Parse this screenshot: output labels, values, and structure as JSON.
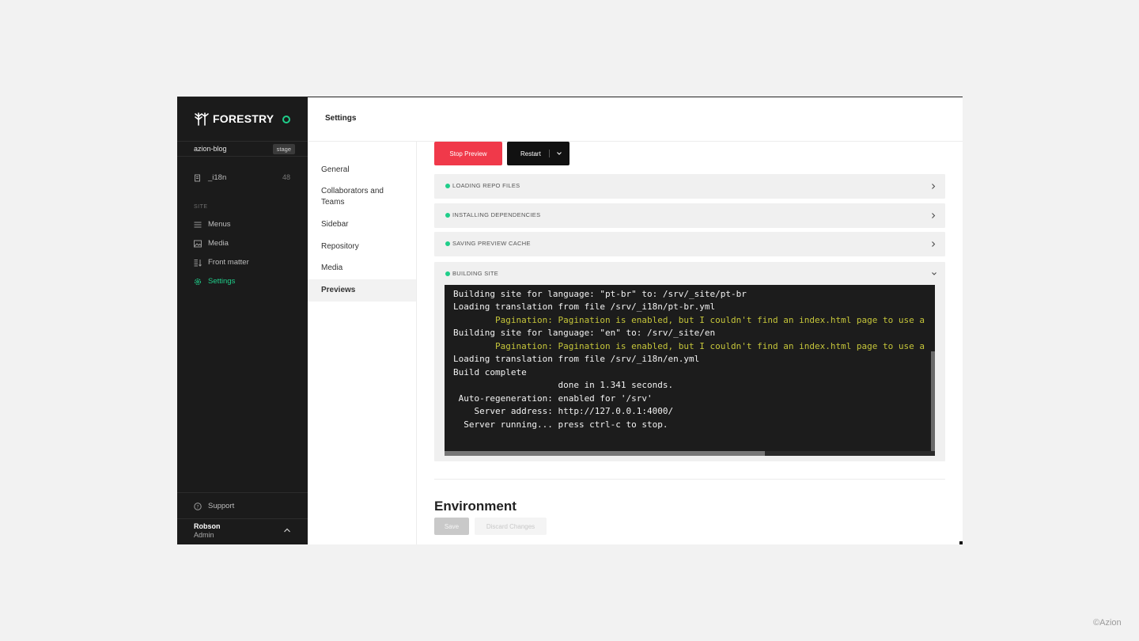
{
  "brand": {
    "name": "FORESTRY"
  },
  "site": {
    "name": "azion-blog",
    "env_badge": "stage"
  },
  "sidebar": {
    "collection": {
      "label": "_i18n",
      "count": "48"
    },
    "section_label": "SITE",
    "items": [
      {
        "label": "Menus",
        "icon": "menu-icon"
      },
      {
        "label": "Media",
        "icon": "image-icon"
      },
      {
        "label": "Front matter",
        "icon": "front-matter-icon"
      },
      {
        "label": "Settings",
        "icon": "gear-icon",
        "active": true
      }
    ],
    "support_label": "Support"
  },
  "user": {
    "name": "Robson",
    "role": "Admin"
  },
  "header": {
    "title": "Settings"
  },
  "settings_nav": {
    "items": [
      {
        "label": "General"
      },
      {
        "label": "Collaborators and Teams"
      },
      {
        "label": "Sidebar"
      },
      {
        "label": "Repository"
      },
      {
        "label": "Media"
      },
      {
        "label": "Previews",
        "active": true
      }
    ]
  },
  "preview": {
    "stop_label": "Stop Preview",
    "restart_label": "Restart",
    "steps": [
      {
        "label": "LOADING REPO FILES",
        "status": "done"
      },
      {
        "label": "INSTALLING DEPENDENCIES",
        "status": "done"
      },
      {
        "label": "SAVING PREVIEW CACHE",
        "status": "done"
      },
      {
        "label": "BUILDING SITE",
        "status": "done",
        "expanded": true
      }
    ],
    "log": [
      {
        "text": "        Pagination: Pagination is enabled, but I couldn't find an index.html page to use a",
        "type": "warn"
      },
      {
        "text": "Building site for language: \"pt-br\" to: /srv/_site/pt-br",
        "type": "normal"
      },
      {
        "text": "Loading translation from file /srv/_i18n/pt-br.yml",
        "type": "normal"
      },
      {
        "text": "        Pagination: Pagination is enabled, but I couldn't find an index.html page to use a",
        "type": "warn"
      },
      {
        "text": "Building site for language: \"en\" to: /srv/_site/en",
        "type": "normal"
      },
      {
        "text": "        Pagination: Pagination is enabled, but I couldn't find an index.html page to use a",
        "type": "warn"
      },
      {
        "text": "Loading translation from file /srv/_i18n/en.yml",
        "type": "normal"
      },
      {
        "text": "Build complete",
        "type": "normal"
      },
      {
        "text": "                    done in 1.341 seconds.",
        "type": "normal"
      },
      {
        "text": " Auto-regeneration: enabled for '/srv'",
        "type": "normal"
      },
      {
        "text": "    Server address: http://127.0.0.1:4000/",
        "type": "normal"
      },
      {
        "text": "  Server running... press ctrl-c to stop.",
        "type": "normal"
      }
    ]
  },
  "environment": {
    "title": "Environment",
    "save_label": "Save",
    "discard_label": "Discard Changes"
  },
  "watermark": "©Azion",
  "colors": {
    "accent": "#1fce8a",
    "danger": "#f0394a",
    "sidebar_bg": "#1b1b1b",
    "terminal_bg": "#1c1c1c",
    "warn_text": "#c5c53a"
  }
}
